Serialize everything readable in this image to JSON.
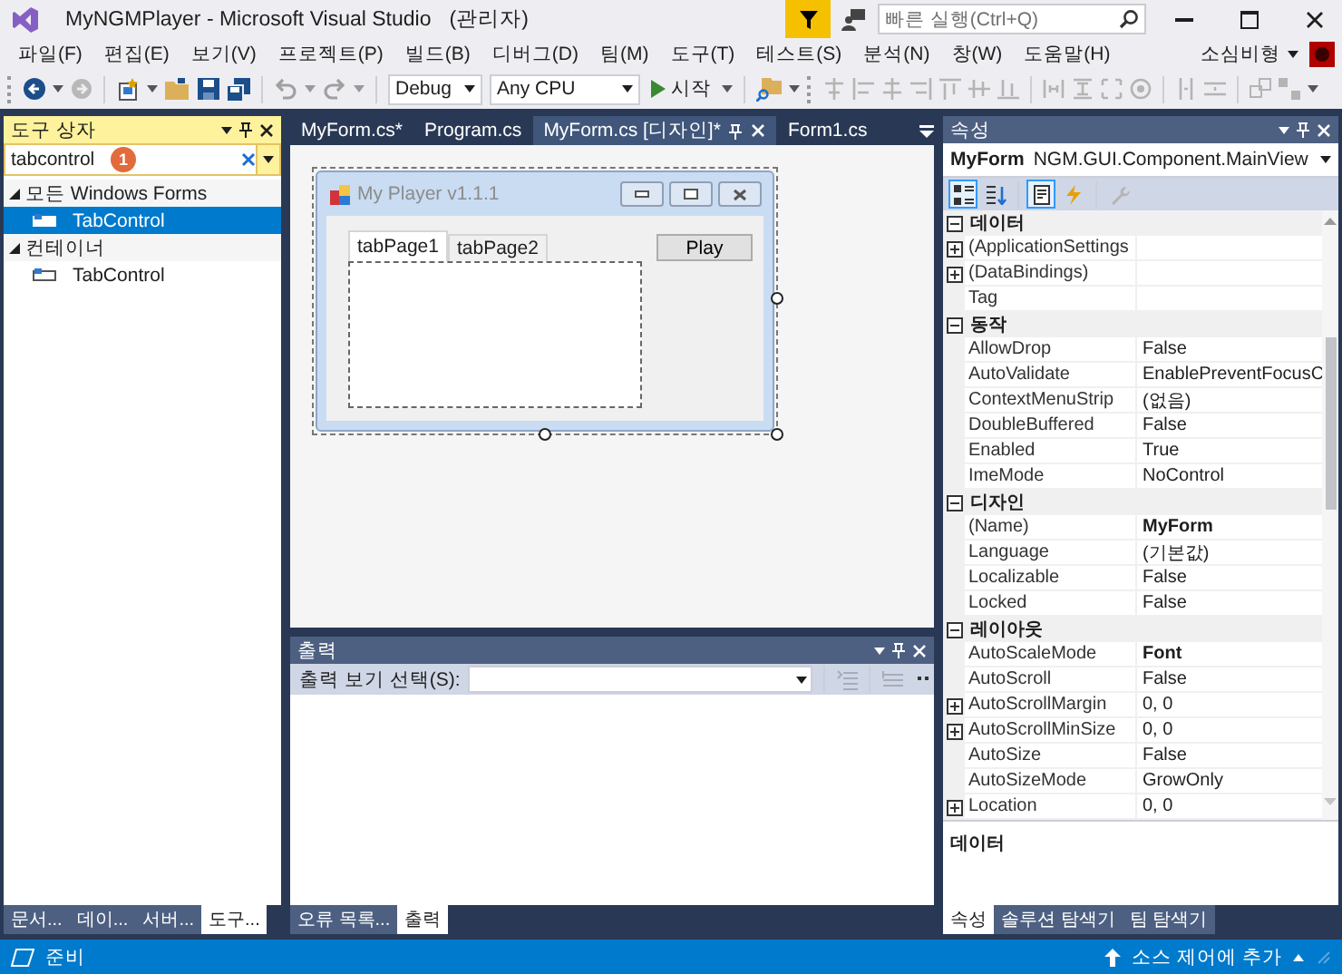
{
  "window": {
    "title": "MyNGMPlayer - Microsoft Visual Studio",
    "role": "(관리자)"
  },
  "quick_launch": {
    "placeholder": "빠른 실행(Ctrl+Q)"
  },
  "menu": [
    "파일(F)",
    "편집(E)",
    "보기(V)",
    "프로젝트(P)",
    "빌드(B)",
    "디버그(D)",
    "팀(M)",
    "도구(T)",
    "테스트(S)",
    "분석(N)",
    "창(W)",
    "도움말(H)"
  ],
  "user": {
    "name": "소심비형"
  },
  "toolbar": {
    "configuration": "Debug",
    "platform": "Any CPU",
    "start": "시작"
  },
  "toolbox": {
    "title": "도구 상자",
    "search": {
      "value": "tabcontrol"
    },
    "badge": "1",
    "groups": [
      {
        "label": "모든 Windows Forms",
        "expanded": true,
        "children": [
          {
            "label": "TabControl",
            "selected": true
          }
        ]
      },
      {
        "label": "컨테이너",
        "expanded": true,
        "children": [
          {
            "label": "TabControl",
            "selected": false
          }
        ]
      }
    ],
    "tabs": [
      {
        "label": "문서...",
        "selected": false
      },
      {
        "label": "데이...",
        "selected": false
      },
      {
        "label": "서버...",
        "selected": false
      },
      {
        "label": "도구...",
        "selected": true
      }
    ]
  },
  "documents": {
    "tabs": [
      {
        "label": "MyForm.cs*",
        "selected": false
      },
      {
        "label": "Program.cs",
        "selected": false
      },
      {
        "label": "MyForm.cs [디자인]*",
        "selected": true
      },
      {
        "label": "Form1.cs",
        "selected": false
      }
    ]
  },
  "designer": {
    "form_title": "My Player v1.1.1",
    "tabs": [
      {
        "label": "tabPage1",
        "selected": true
      },
      {
        "label": "tabPage2",
        "selected": false
      }
    ],
    "button": "Play"
  },
  "output": {
    "title": "출력",
    "source_label": "출력 보기 선택(S):"
  },
  "bottom_tabs": [
    {
      "label": "오류 목록...",
      "selected": false
    },
    {
      "label": "출력",
      "selected": true
    }
  ],
  "properties": {
    "title": "속성",
    "object_name": "MyForm",
    "object_type": "NGM.GUI.Component.MainView",
    "view_buttons": [
      {
        "kind": "categorized",
        "selected": true
      },
      {
        "kind": "alphabetical",
        "selected": false
      },
      {
        "kind": "properties",
        "selected": true
      },
      {
        "kind": "events",
        "selected": false
      },
      {
        "kind": "pages",
        "selected": false
      }
    ],
    "sections": [
      {
        "name": "데이터",
        "expanded": true,
        "rows": [
          {
            "name": "(ApplicationSettings",
            "expandable": true,
            "modified": false
          },
          {
            "name": "(DataBindings)",
            "expandable": true,
            "modified": false
          },
          {
            "name": "Tag",
            "expandable": false,
            "modified": false
          }
        ]
      },
      {
        "name": "동작",
        "expanded": true,
        "rows": [
          {
            "name": "AllowDrop",
            "value": "False",
            "expandable": false,
            "modified": false
          },
          {
            "name": "AutoValidate",
            "value": "EnablePreventFocusC",
            "expandable": false,
            "modified": false
          },
          {
            "name": "ContextMenuStrip",
            "value": "(없음)",
            "expandable": false,
            "modified": false
          },
          {
            "name": "DoubleBuffered",
            "value": "False",
            "expandable": false,
            "modified": false
          },
          {
            "name": "Enabled",
            "value": "True",
            "expandable": false,
            "modified": false
          },
          {
            "name": "ImeMode",
            "value": "NoControl",
            "expandable": false,
            "modified": false
          }
        ]
      },
      {
        "name": "디자인",
        "expanded": true,
        "rows": [
          {
            "name": "(Name)",
            "value": "MyForm",
            "expandable": false,
            "modified": true
          },
          {
            "name": "Language",
            "value": "(기본값)",
            "expandable": false,
            "modified": false
          },
          {
            "name": "Localizable",
            "value": "False",
            "expandable": false,
            "modified": false
          },
          {
            "name": "Locked",
            "value": "False",
            "expandable": false,
            "modified": false
          }
        ]
      },
      {
        "name": "레이아웃",
        "expanded": true,
        "rows": [
          {
            "name": "AutoScaleMode",
            "value": "Font",
            "expandable": false,
            "modified": true
          },
          {
            "name": "AutoScroll",
            "value": "False",
            "expandable": false,
            "modified": false
          },
          {
            "name": "AutoScrollMargin",
            "value": "0, 0",
            "expandable": true,
            "modified": false
          },
          {
            "name": "AutoScrollMinSize",
            "value": "0, 0",
            "expandable": true,
            "modified": false
          },
          {
            "name": "AutoSize",
            "value": "False",
            "expandable": false,
            "modified": false
          },
          {
            "name": "AutoSizeMode",
            "value": "GrowOnly",
            "expandable": false,
            "modified": false
          },
          {
            "name": "Location",
            "value": "0, 0",
            "expandable": true,
            "modified": false
          }
        ]
      }
    ],
    "description": "데이터",
    "tabs": [
      {
        "label": "속성",
        "selected": true
      },
      {
        "label": "솔루션 탐색기",
        "selected": false
      },
      {
        "label": "팀 탐색기",
        "selected": false
      }
    ]
  },
  "status_bar": {
    "text": "준비",
    "action": "소스 제어에 추가"
  }
}
